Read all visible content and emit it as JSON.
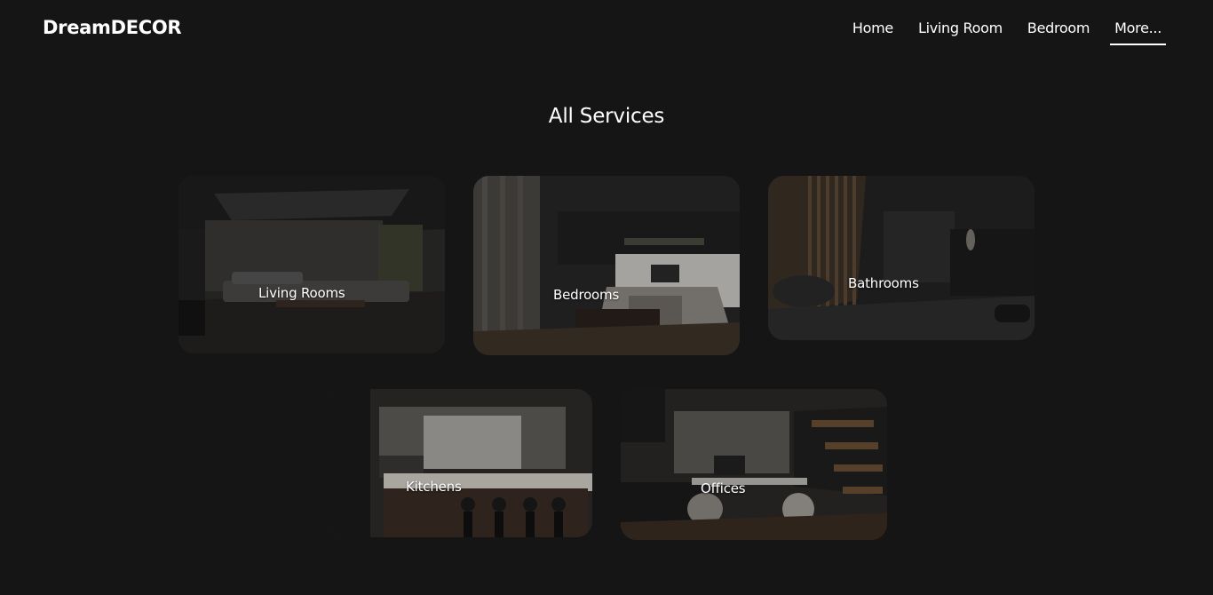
{
  "header": {
    "logo": "DreamDECOR",
    "nav": [
      {
        "label": "Home"
      },
      {
        "label": "Living Room"
      },
      {
        "label": "Bedroom"
      },
      {
        "label": "More..."
      }
    ],
    "active_nav": "More..."
  },
  "main": {
    "title": "All Services",
    "cards": [
      {
        "label": "Living Rooms"
      },
      {
        "label": "Bedrooms"
      },
      {
        "label": "Bathrooms"
      },
      {
        "label": "Kitchens"
      },
      {
        "label": "Offices"
      }
    ]
  },
  "colors": {
    "background": "#151515",
    "text": "#ffffff"
  }
}
